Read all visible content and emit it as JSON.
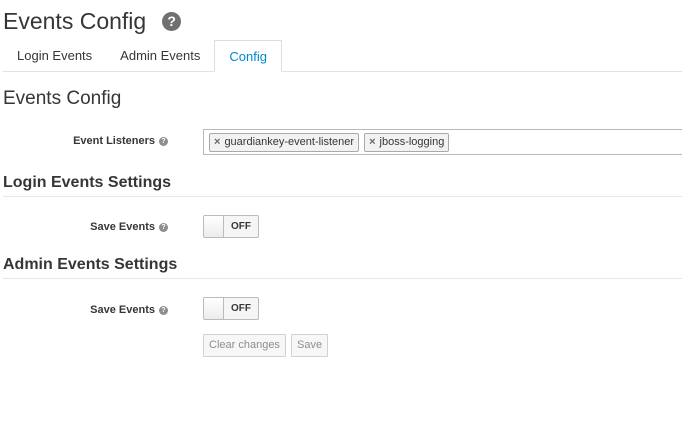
{
  "header": {
    "title": "Events Config",
    "help_icon": "question-circle-icon"
  },
  "tabs": [
    {
      "label": "Login Events",
      "active": false
    },
    {
      "label": "Admin Events",
      "active": false
    },
    {
      "label": "Config",
      "active": true
    }
  ],
  "main": {
    "section_title": "Events Config",
    "event_listeners": {
      "label": "Event Listeners",
      "tags": [
        "guardiankey-event-listener",
        "jboss-logging"
      ]
    },
    "login_settings": {
      "title": "Login Events Settings",
      "save_events_label": "Save Events",
      "save_events_state": "OFF"
    },
    "admin_settings": {
      "title": "Admin Events Settings",
      "save_events_label": "Save Events",
      "save_events_state": "OFF"
    },
    "buttons": {
      "clear": "Clear changes",
      "save": "Save"
    }
  },
  "colors": {
    "active_tab": "#0088ce",
    "text": "#363636",
    "muted": "#8b8d8f"
  }
}
